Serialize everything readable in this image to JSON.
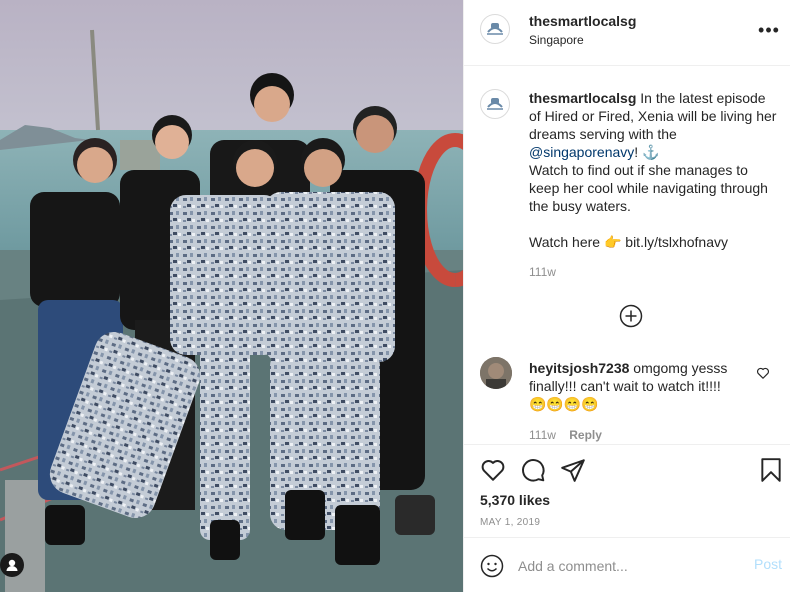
{
  "post": {
    "username": "thesmartlocalsg",
    "location": "Singapore",
    "caption": {
      "username": "thesmartlocalsg",
      "text_1": "In the latest episode of Hired or Fired, Xenia will be living her dreams serving with the",
      "mention": "@singaporenavy",
      "text_2": "! ⚓",
      "line_2": "Watch to find out if she manages to keep her cool while navigating through the busy waters.",
      "line_3": "Watch here 👉 bit.ly/tslxhofnavy"
    },
    "caption_time": "111w",
    "likes": "5,370 likes",
    "date": "MAY 1, 2019"
  },
  "comments": [
    {
      "username": "heyitsjosh7238",
      "text": "omgomg yesss finally!!! can't wait to watch it!!!!",
      "emoji": "😁😁😁😁",
      "time": "111w",
      "reply_label": "Reply"
    }
  ],
  "add_comment": {
    "placeholder": "Add a comment...",
    "post_label": "Post"
  },
  "icons": {
    "more": "more-options-icon",
    "load_more": "plus-circle-icon",
    "like": "heart-icon",
    "comment": "comment-icon",
    "share": "share-icon",
    "save": "bookmark-icon",
    "emoji": "emoji-icon",
    "tag": "user-tag-icon"
  },
  "colors": {
    "link": "#00376b",
    "post_disabled": "#b2dffc",
    "muted": "#8e8e8e"
  }
}
